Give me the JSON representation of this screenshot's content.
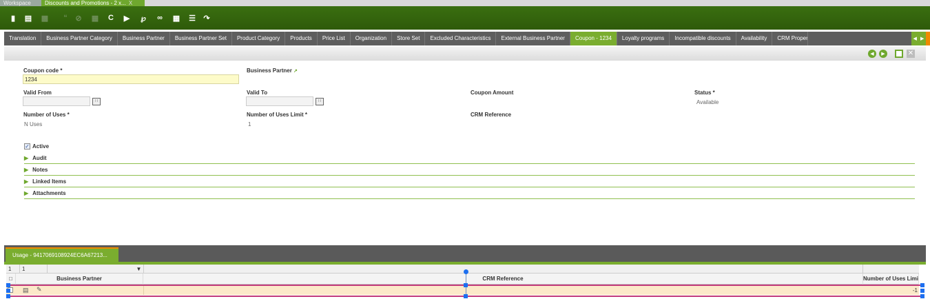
{
  "top_tabs": {
    "workspace": "Workspace",
    "active": "Discounts and Promotions - 2 x...",
    "close": "X"
  },
  "toolbar": {
    "icons": [
      "new-document-icon",
      "new-row-icon",
      "save-icon",
      "undo-icon",
      "delete-row-icon",
      "trash-icon",
      "refresh-icon",
      "export-icon",
      "attachment-icon",
      "link-icon",
      "print-icon",
      "grid-toggle-icon",
      "split-view-icon"
    ]
  },
  "tabs": [
    {
      "label": "Translation"
    },
    {
      "label": "Business Partner Category"
    },
    {
      "label": "Business Partner"
    },
    {
      "label": "Business Partner Set"
    },
    {
      "label": "Product Category"
    },
    {
      "label": "Products"
    },
    {
      "label": "Price List"
    },
    {
      "label": "Organization"
    },
    {
      "label": "Store Set"
    },
    {
      "label": "Excluded Characteristics"
    },
    {
      "label": "External Business Partner"
    },
    {
      "label": "Coupon - 1234"
    },
    {
      "label": "Loyalty programs"
    },
    {
      "label": "Incompatible discounts"
    },
    {
      "label": "Availability"
    },
    {
      "label": "CRM Property"
    }
  ],
  "active_tab": "Coupon - 1234",
  "form": {
    "coupon_code_label": "Coupon code *",
    "coupon_code_value": "1234",
    "business_partner_label": "Business Partner",
    "valid_from_label": "Valid From",
    "valid_from_value": "",
    "valid_to_label": "Valid To",
    "valid_to_value": "",
    "coupon_amount_label": "Coupon Amount",
    "status_label": "Status *",
    "status_value": "Available",
    "number_of_uses_label": "Number of Uses *",
    "number_of_uses_value": "N Uses",
    "number_of_uses_limit_label": "Number of Uses Limit *",
    "number_of_uses_limit_value": "1",
    "crm_reference_label": "CRM Reference",
    "active_label": "Active",
    "active_checked": true
  },
  "sections": [
    "Audit",
    "Notes",
    "Linked Items",
    "Attachments"
  ],
  "subtab": {
    "label": "Usage - 9417069108924EC6A67213..."
  },
  "grid": {
    "filter": {
      "page_a": "1",
      "page_b": "1"
    },
    "columns": [
      "Business Partner",
      "CRM Reference",
      "Number of Uses Limit"
    ],
    "rows": [
      {
        "business_partner": "",
        "crm_reference": "",
        "number_of_uses_limit": "-1"
      }
    ]
  },
  "colors": {
    "accent": "#7aad2f",
    "toolbar": "#2e5a0a",
    "required_field": "#fdfbc9",
    "selected_row": "#fce9c9"
  }
}
